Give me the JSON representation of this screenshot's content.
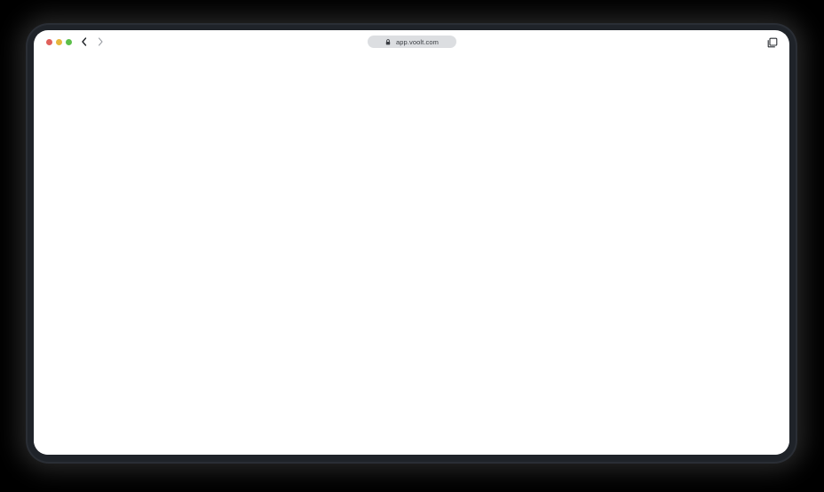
{
  "browser": {
    "window_controls": {
      "close_color": "#e0605a",
      "minimize_color": "#e6b73c",
      "maximize_color": "#5cbf4a"
    },
    "icons": {
      "back": "chevron-left-icon",
      "forward": "chevron-right-icon",
      "lock": "lock-icon",
      "tabs": "tabs-overview-icon"
    },
    "address_bar": {
      "url": "app.voolt.com"
    }
  },
  "page": {
    "background": "#ffffff"
  }
}
